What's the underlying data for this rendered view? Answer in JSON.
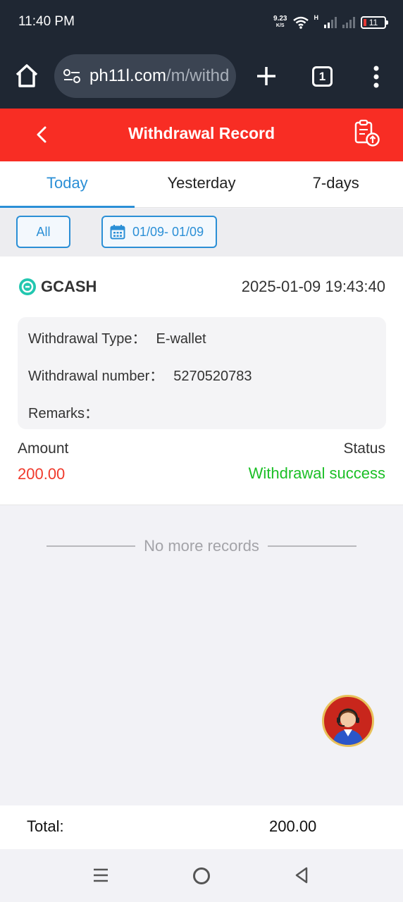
{
  "status_bar": {
    "time": "11:40 PM",
    "net_speed": "9.23",
    "net_unit": "K/S",
    "network_type": "H",
    "battery": "11"
  },
  "browser": {
    "url_host": "ph11l.com",
    "url_path": "/m/withd",
    "tab_count": "1"
  },
  "header": {
    "title": "Withdrawal Record"
  },
  "tabs": [
    {
      "label": "Today",
      "active": true
    },
    {
      "label": "Yesterday",
      "active": false
    },
    {
      "label": "7-days",
      "active": false
    }
  ],
  "filters": {
    "type": "All",
    "date_range": "01/09- 01/09"
  },
  "record": {
    "channel": "GCASH",
    "datetime": "2025-01-09 19:43:40",
    "type_label": "Withdrawal Type：",
    "type_value": "E-wallet",
    "number_label": "Withdrawal number：",
    "number_value": "5270520783",
    "remarks_label": "Remarks：",
    "amount_label": "Amount",
    "amount_value": "200.00",
    "status_label": "Status",
    "status_value": "Withdrawal success"
  },
  "list_end": "No more records",
  "total": {
    "label": "Total:",
    "value": "200.00"
  },
  "colors": {
    "header_red": "#f82d24",
    "accent_blue": "#2b8fd6",
    "amount_red": "#f0392b",
    "success_green": "#1bbf26",
    "gcash_teal": "#22c7b0"
  }
}
